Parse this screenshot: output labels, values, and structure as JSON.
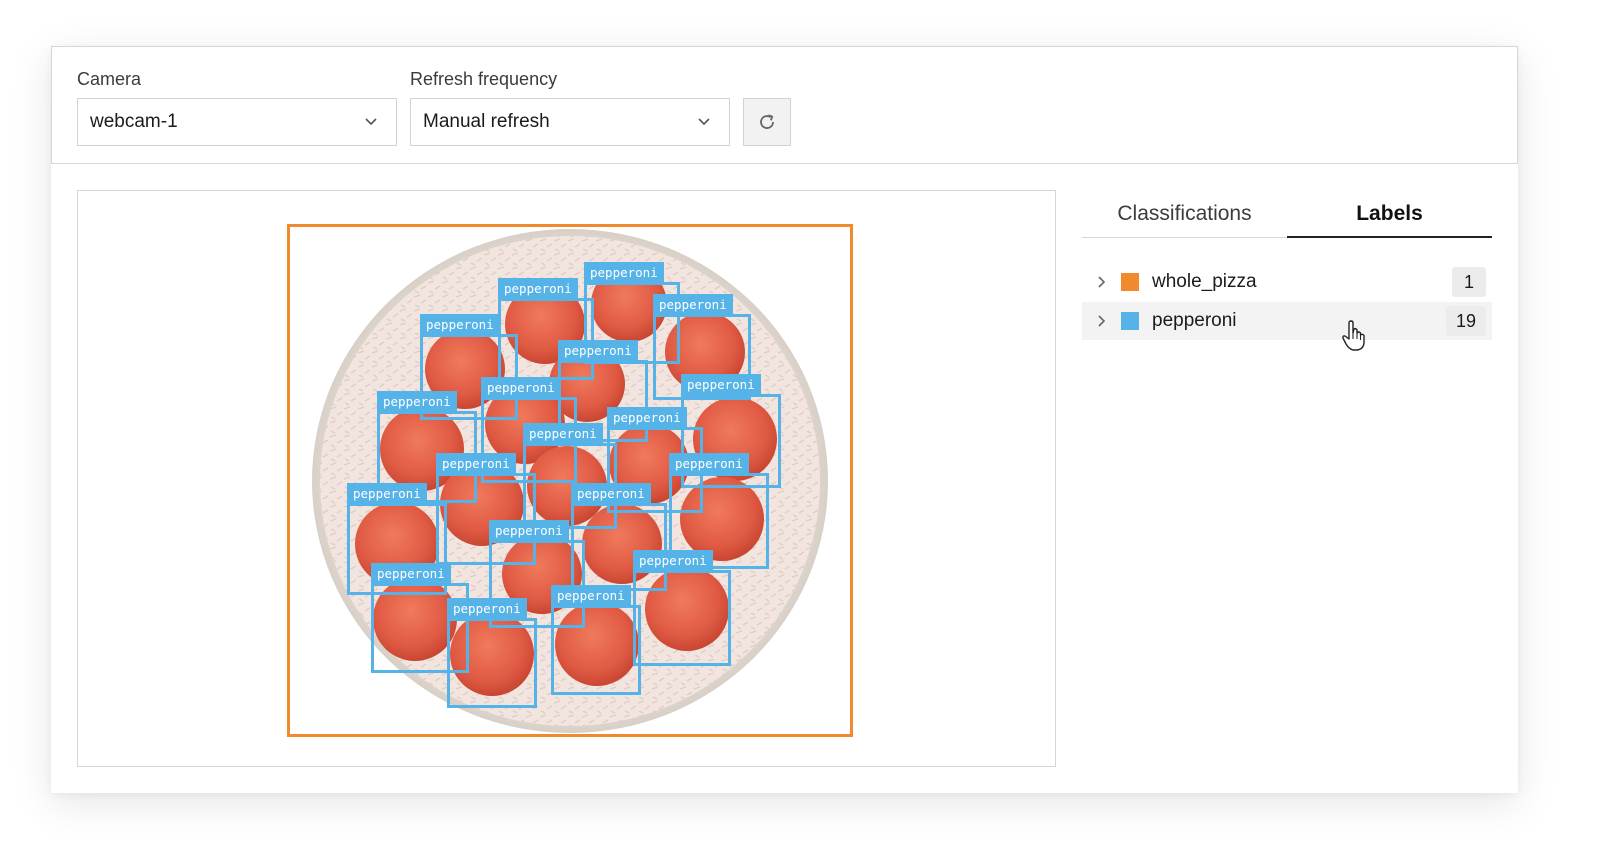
{
  "toolbar": {
    "camera": {
      "label": "Camera",
      "value": "webcam-1"
    },
    "refresh": {
      "label": "Refresh frequency",
      "value": "Manual refresh"
    },
    "refresh_button_icon": "refresh-icon"
  },
  "annotations": {
    "whole_pizza": {
      "label_color": "#f08a2c"
    },
    "pepperoni_label": "pepperoni",
    "pepperoni_color": "#55b3e8"
  },
  "sidebar": {
    "tabs": [
      {
        "label": "Classifications",
        "active": false
      },
      {
        "label": "Labels",
        "active": true
      }
    ],
    "labels": [
      {
        "name": "whole_pizza",
        "color": "#f08a2c",
        "count": "1"
      },
      {
        "name": "pepperoni",
        "color": "#55b3e8",
        "count": "19"
      }
    ]
  }
}
